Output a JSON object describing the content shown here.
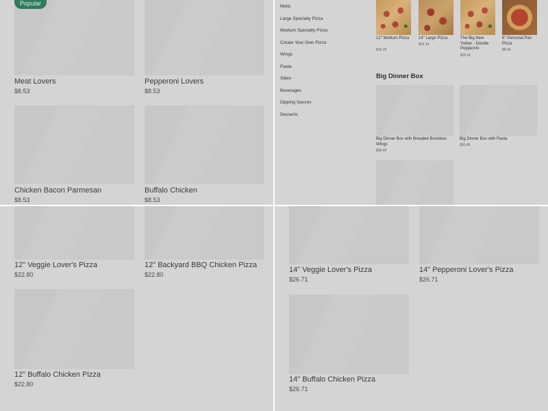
{
  "popular_badge": "Popular",
  "top_left": {
    "items": [
      {
        "name": "Meat Lovers",
        "price": "$8.53"
      },
      {
        "name": "Pepperoni Lovers",
        "price": "$8.53"
      },
      {
        "name": "Chicken Bacon Parmesan",
        "price": "$8.53"
      },
      {
        "name": "Buffalo Chicken",
        "price": "$8.53"
      }
    ]
  },
  "categories": [
    "Melts",
    "Large Specialty Pizza",
    "Medium Specialty Pizza",
    "Create Your Own Pizza",
    "Wings",
    "Pasta",
    "Sides",
    "Beverages",
    "Dipping Sauces",
    "Desserts"
  ],
  "featured": [
    {
      "name": "12\" Medium Pizza",
      "price": "$16.70"
    },
    {
      "name": "14\" Large Pizza",
      "price": "$19.14"
    },
    {
      "name": "The Big New Yorker - Double Pepperoni",
      "price": "$25.61"
    },
    {
      "name": "6\" Personal Pan Pizza",
      "price": "$6.94"
    }
  ],
  "big_dinner_box": {
    "heading": "Big Dinner Box",
    "items": [
      {
        "name": "Big Dinner Box with Breaded Boneless Wings",
        "price": "$30.49"
      },
      {
        "name": "Big Dinner Box with Pasta",
        "price": "$30.49"
      }
    ]
  },
  "bottom_left": {
    "items": [
      {
        "name": "12\" Veggie Lover's Pizza",
        "price": "$22.80"
      },
      {
        "name": "12\" Backyard BBQ Chicken Pizza",
        "price": "$22.80"
      },
      {
        "name": "12\" Buffalo Chicken Pizza",
        "price": "$22.80"
      }
    ]
  },
  "bottom_right": {
    "items": [
      {
        "name": "14\" Veggie Lover's Pizza",
        "price": "$26.71"
      },
      {
        "name": "14\" Pepperoni Lover's Pizza",
        "price": "$26.71"
      },
      {
        "name": "14\" Buffalo Chicken Pizza",
        "price": "$26.71"
      }
    ]
  }
}
